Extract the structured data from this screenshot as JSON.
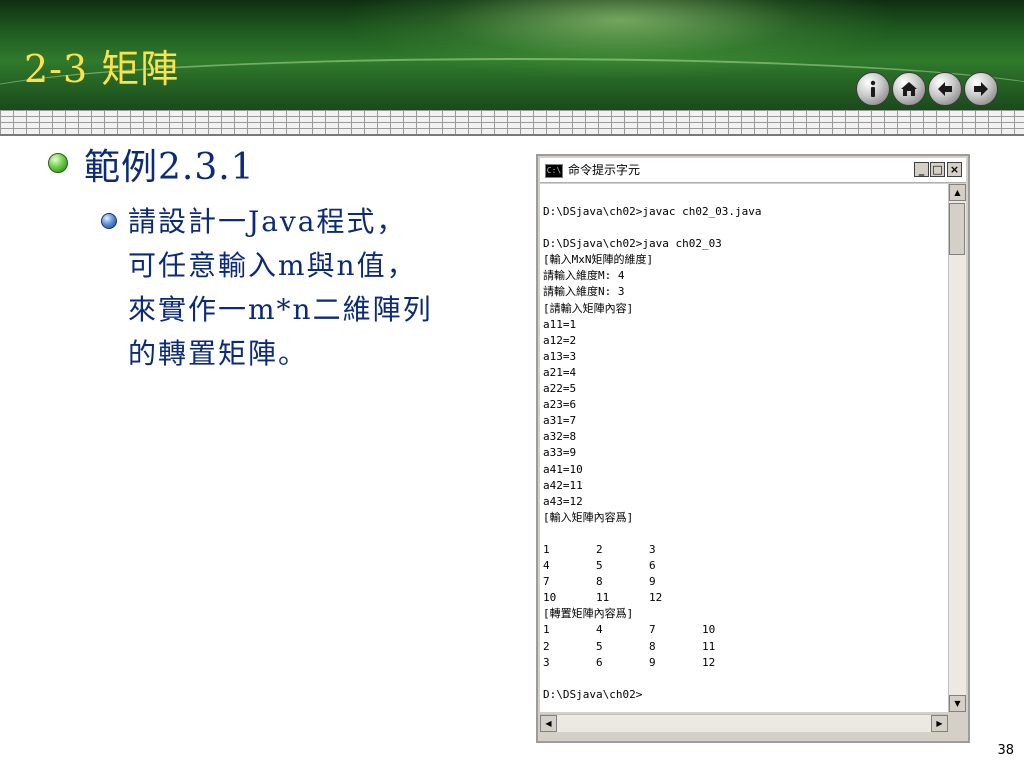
{
  "slide": {
    "title": "2-3 矩陣",
    "page_number": "38"
  },
  "nav": {
    "info_icon": "info-icon",
    "home_icon": "home-icon",
    "back_icon": "arrow-left-icon",
    "forward_icon": "arrow-right-icon"
  },
  "content": {
    "bullet1": "範例2.3.1",
    "bullet2_lines": [
      "請設計一Java程式，",
      "可任意輸入m與n值，",
      "來實作一m*n二維陣列",
      "的轉置矩陣。"
    ]
  },
  "console": {
    "title": "命令提示字元",
    "icon_text": "C:\\",
    "buttons": {
      "minimize": "_",
      "maximize": "□",
      "close": "×"
    },
    "lines": [
      "D:\\DSjava\\ch02>javac ch02_03.java",
      "",
      "D:\\DSjava\\ch02>java ch02_03",
      "[輸入MxN矩陣的維度]",
      "請輸入維度M: 4",
      "請輸入維度N: 3",
      "[請輸入矩陣內容]",
      "a11=1",
      "a12=2",
      "a13=3",
      "a21=4",
      "a22=5",
      "a23=6",
      "a31=7",
      "a32=8",
      "a33=9",
      "a41=10",
      "a42=11",
      "a43=12",
      "[輸入矩陣內容爲]",
      "",
      "1       2       3",
      "4       5       6",
      "7       8       9",
      "10      11      12",
      "[轉置矩陣內容爲]",
      "1       4       7       10",
      "2       5       8       11",
      "3       6       9       12",
      "",
      "D:\\DSjava\\ch02>"
    ]
  },
  "colors": {
    "title": "#ffe14a",
    "body_text": "#0b2a7a",
    "header_green": "#2f7a2c"
  }
}
